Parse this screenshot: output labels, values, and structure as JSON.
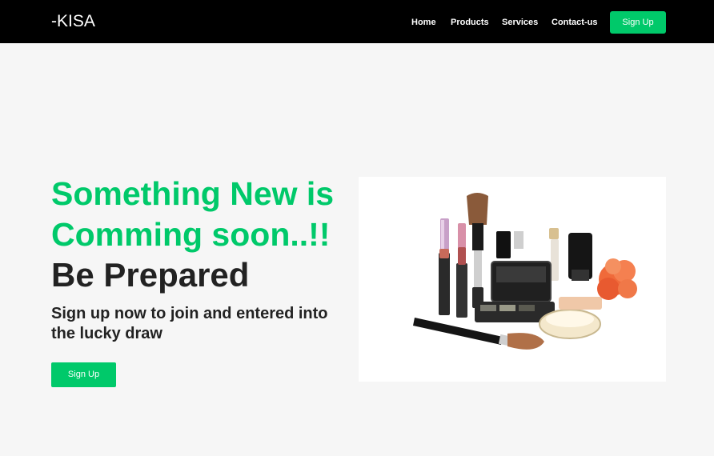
{
  "navbar": {
    "brand": "-KISA",
    "links": [
      "Home",
      "Products",
      "Services",
      "Contact-us"
    ],
    "signup_label": "Sign Up",
    "background": "#000000"
  },
  "hero": {
    "headline_line1": "Something New is",
    "headline_line2": "Comming soon..!!",
    "headline_line3": "Be Prepared",
    "subtext": "Sign up now to join and entered into the lucky draw",
    "signup_label": "Sign Up",
    "accent_color": "#00c96a",
    "image_subject": "cosmetics and makeup products"
  }
}
